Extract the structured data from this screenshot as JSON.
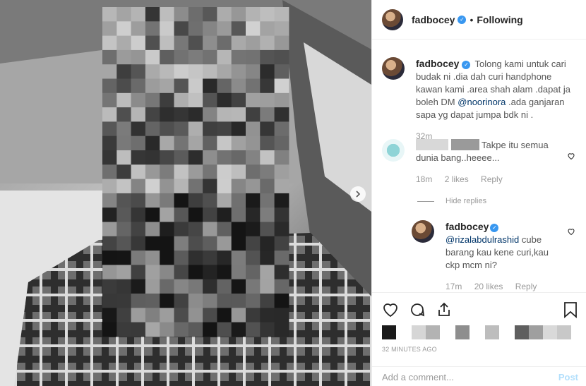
{
  "post": {
    "username": "fadbocey",
    "follow_status": "Following",
    "dot": "•"
  },
  "caption": {
    "username": "fadbocey",
    "text_before": "Tolong kami untuk cari budak ni .dia dah curi handphone kawan kami .area shah alam .dapat ja boleh DM",
    "mention": "@noorinora",
    "text_after": ".ada ganjaran sapa yg dapat jumpa bdk ni .",
    "time": "32m"
  },
  "comment": {
    "text": "Takpe itu semua dunia bang..heeee...",
    "time": "18m",
    "likes": "2 likes",
    "reply": "Reply",
    "hide_replies": "Hide replies"
  },
  "reply_comment": {
    "username": "fadbocey",
    "mention": "@rizalabdulrashid",
    "text": "cube barang kau kene curi,kau ckp mcm ni?",
    "time": "17m",
    "likes": "20 likes",
    "reply": "Reply"
  },
  "actions": {
    "timestamp": "32 MINUTES AGO",
    "add_comment_placeholder": "Add a comment...",
    "post_label": "Post"
  },
  "colors": {
    "link": "#003569",
    "verified": "#3897f0",
    "muted": "#999999",
    "post_button": "#b2dffc"
  },
  "icons": [
    "verified-badge-icon",
    "heart-icon",
    "comment-icon",
    "share-icon",
    "bookmark-icon",
    "small-heart-icon",
    "next-arrow-icon"
  ]
}
